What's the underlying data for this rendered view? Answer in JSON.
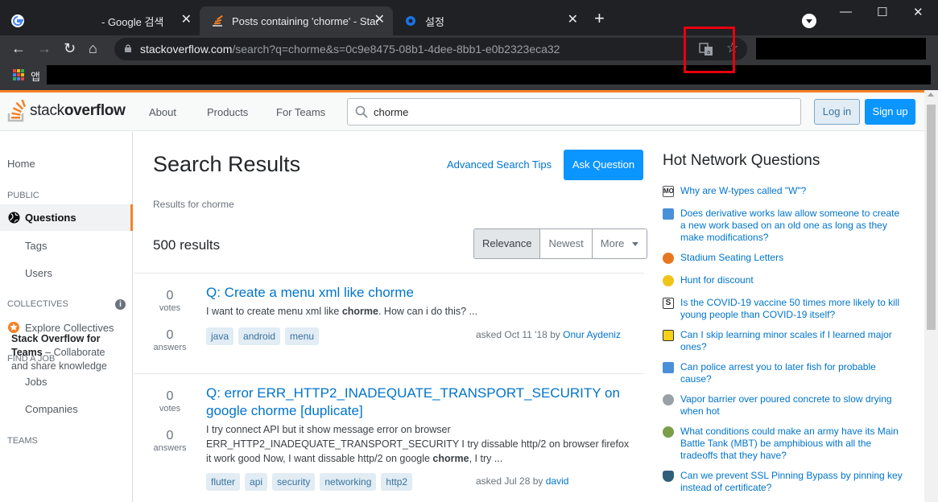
{
  "browser": {
    "tabs": [
      {
        "title": "- Google 검색"
      },
      {
        "title": "Posts containing 'chorme' - Stac"
      },
      {
        "title": "설정"
      }
    ],
    "url_host": "stackoverflow.com",
    "url_path": "/search?q=chorme&s=0c9e8475-08b1-4dee-8bb1-e0b2323eca32",
    "bookmarks_apps_label": "앱"
  },
  "header": {
    "logo_left": "stack",
    "logo_right": "overflow",
    "nav": [
      "About",
      "Products",
      "For Teams"
    ],
    "search_value": "chorme",
    "login": "Log in",
    "signup": "Sign up"
  },
  "sidebar": {
    "home": "Home",
    "public": "PUBLIC",
    "questions": "Questions",
    "tags": "Tags",
    "users": "Users",
    "collectives": "COLLECTIVES",
    "explore_collectives": "Explore Collectives",
    "find_a_job": "FIND A JOB",
    "jobs": "Jobs",
    "companies": "Companies",
    "teams": "TEAMS",
    "teams_title": "Stack Overflow for Teams",
    "teams_text": " – Collaborate and share knowledge"
  },
  "main": {
    "title": "Search Results",
    "advanced_tips": "Advanced Search Tips",
    "ask": "Ask Question",
    "results_for": "Results for chorme",
    "count": "500 results",
    "filters": [
      "Relevance",
      "Newest",
      "More"
    ],
    "votes_label": "votes",
    "answers_label": "answers",
    "questions": [
      {
        "votes": "0",
        "answers": "0",
        "title": "Q: Create a menu xml like chorme",
        "excerpt_pre": "I want to create menu xml like ",
        "excerpt_bold": "chorme",
        "excerpt_post": ". How can i do this? ...",
        "tags": [
          "java",
          "android",
          "menu"
        ],
        "asked": "asked Oct 11 '18 by ",
        "user": "Onur Aydeniz"
      },
      {
        "votes": "0",
        "answers": "0",
        "title": "Q: error ERR_HTTP2_INADEQUATE_TRANSPORT_SECURITY on google chorme [duplicate]",
        "excerpt_pre": "I try connect API but it show message error on browser ERR_HTTP2_INADEQUATE_TRANSPORT_SECURITY I try dissable http/2 on browser firefox it work good Now, I want dissable http/2 on google ",
        "excerpt_bold": "chorme",
        "excerpt_post": ", I try ...",
        "tags": [
          "flutter",
          "api",
          "security",
          "networking",
          "http2"
        ],
        "asked": "asked Jul 28 by ",
        "user": "david"
      }
    ]
  },
  "hot_network": {
    "title": "Hot Network Questions",
    "items": [
      {
        "text": "Why are W-types called \"W\"?",
        "icon": "mathoverflow-icon",
        "color": "#ffffff"
      },
      {
        "text": "Does derivative works law allow someone to create a new work based on an old one as long as they make modifications?",
        "icon": "law-icon",
        "color": "#4a90d9"
      },
      {
        "text": "Stadium Seating Letters",
        "icon": "puzzling-icon",
        "color": "#e87722"
      },
      {
        "text": "Hunt for discount",
        "icon": "gold-medal-icon",
        "color": "#f0c419"
      },
      {
        "text": "Is the COVID-19 vaccine 50 times more likely to kill young people than COVID-19 itself?",
        "icon": "skeptics-icon",
        "color": "#ffffff"
      },
      {
        "text": "Can I skip learning minor scales if I learned major ones?",
        "icon": "music-icon",
        "color": "#f7d117"
      },
      {
        "text": "Can police arrest you to later fish for probable cause?",
        "icon": "law-icon",
        "color": "#4a90d9"
      },
      {
        "text": "Vapor barrier over poured concrete to slow drying when hot",
        "icon": "diy-icon",
        "color": "#9aa0a6"
      },
      {
        "text": "What conditions could make an army have its Main Battle Tank (MBT) be amphibious with all the tradeoffs that they have?",
        "icon": "worldbuilding-icon",
        "color": "#7a9e4c"
      },
      {
        "text": "Can we prevent SSL Pinning Bypass by pinning key instead of certificate?",
        "icon": "security-icon",
        "color": "#2f5f7a"
      }
    ]
  }
}
